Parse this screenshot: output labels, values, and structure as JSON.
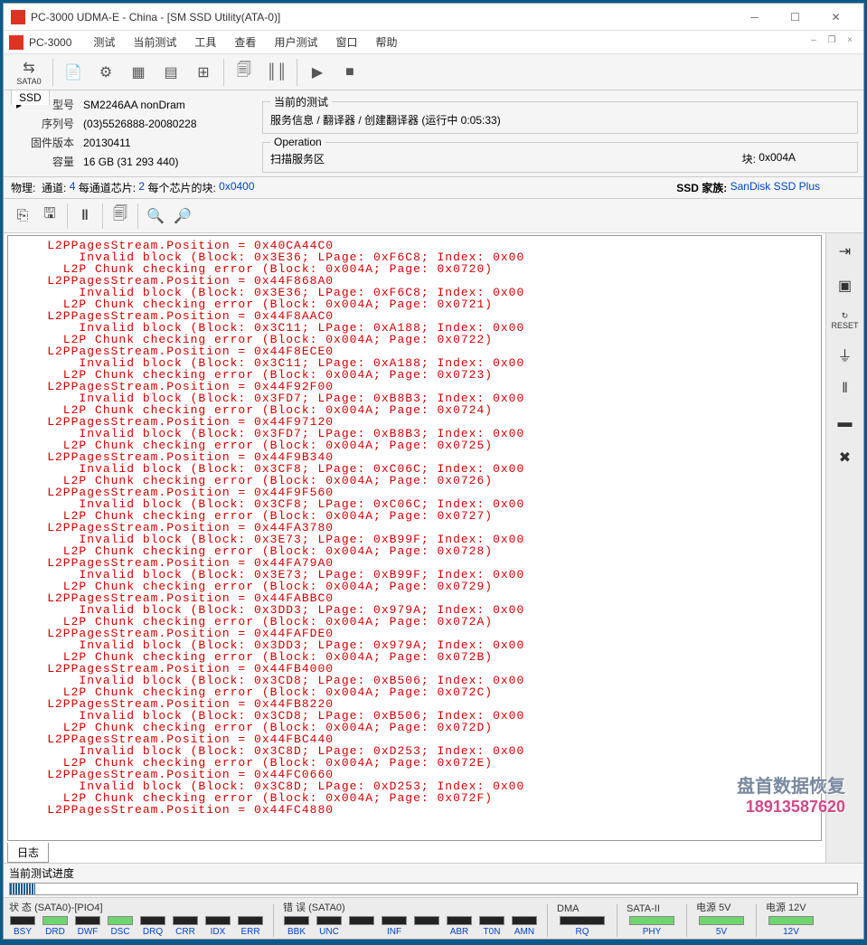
{
  "title": "PC-3000 UDMA-E - China - [SM SSD Utility(ATA-0)]",
  "app_name": "PC-3000",
  "menu": [
    "测试",
    "当前测试",
    "工具",
    "查看",
    "用户测试",
    "窗口",
    "帮助"
  ],
  "toolbar_port_label": "SATA0",
  "ssd_tab": "SSD",
  "info": {
    "model_label": "型号",
    "model": "SM2246AA nonDram",
    "serial_label": "序列号",
    "serial": "(03)5526888-20080228",
    "fw_label": "固件版本",
    "fw": "20130411",
    "cap_label": "容量",
    "cap": "16 GB (31 293 440)"
  },
  "current_test": {
    "legend": "当前的测试",
    "text": "服务信息 / 翻译器 / 创建翻译器 (运行中 0:05:33)"
  },
  "operation": {
    "legend": "Operation",
    "text": "扫描服务区",
    "block_label": "块:",
    "block_value": "0x004A"
  },
  "phys": {
    "label1": "物理:",
    "ch_label": "通道:",
    "ch": "4",
    "perch_label": "每通道芯片:",
    "perch": "2",
    "blocks_label": "每个芯片的块:",
    "blocks": "0x0400",
    "ssd_family_label": "SSD 家族:",
    "ssd_family": "SanDisk SSD Plus"
  },
  "log_lines": [
    "    L2PPagesStream.Position = 0x40CA44C0",
    "        Invalid block (Block: 0x3E36; LPage: 0xF6C8; Index: 0x00",
    "      L2P Chunk checking error (Block: 0x004A; Page: 0x0720)",
    "    L2PPagesStream.Position = 0x44F868A0",
    "        Invalid block (Block: 0x3E36; LPage: 0xF6C8; Index: 0x00",
    "      L2P Chunk checking error (Block: 0x004A; Page: 0x0721)",
    "    L2PPagesStream.Position = 0x44F8AAC0",
    "        Invalid block (Block: 0x3C11; LPage: 0xA188; Index: 0x00",
    "      L2P Chunk checking error (Block: 0x004A; Page: 0x0722)",
    "    L2PPagesStream.Position = 0x44F8ECE0",
    "        Invalid block (Block: 0x3C11; LPage: 0xA188; Index: 0x00",
    "      L2P Chunk checking error (Block: 0x004A; Page: 0x0723)",
    "    L2PPagesStream.Position = 0x44F92F00",
    "        Invalid block (Block: 0x3FD7; LPage: 0xB8B3; Index: 0x00",
    "      L2P Chunk checking error (Block: 0x004A; Page: 0x0724)",
    "    L2PPagesStream.Position = 0x44F97120",
    "        Invalid block (Block: 0x3FD7; LPage: 0xB8B3; Index: 0x00",
    "      L2P Chunk checking error (Block: 0x004A; Page: 0x0725)",
    "    L2PPagesStream.Position = 0x44F9B340",
    "        Invalid block (Block: 0x3CF8; LPage: 0xC06C; Index: 0x00",
    "      L2P Chunk checking error (Block: 0x004A; Page: 0x0726)",
    "    L2PPagesStream.Position = 0x44F9F560",
    "        Invalid block (Block: 0x3CF8; LPage: 0xC06C; Index: 0x00",
    "      L2P Chunk checking error (Block: 0x004A; Page: 0x0727)",
    "    L2PPagesStream.Position = 0x44FA3780",
    "        Invalid block (Block: 0x3E73; LPage: 0xB99F; Index: 0x00",
    "      L2P Chunk checking error (Block: 0x004A; Page: 0x0728)",
    "    L2PPagesStream.Position = 0x44FA79A0",
    "        Invalid block (Block: 0x3E73; LPage: 0xB99F; Index: 0x00",
    "      L2P Chunk checking error (Block: 0x004A; Page: 0x0729)",
    "    L2PPagesStream.Position = 0x44FABBC0",
    "        Invalid block (Block: 0x3DD3; LPage: 0x979A; Index: 0x00",
    "      L2P Chunk checking error (Block: 0x004A; Page: 0x072A)",
    "    L2PPagesStream.Position = 0x44FAFDE0",
    "        Invalid block (Block: 0x3DD3; LPage: 0x979A; Index: 0x00",
    "      L2P Chunk checking error (Block: 0x004A; Page: 0x072B)",
    "    L2PPagesStream.Position = 0x44FB4000",
    "        Invalid block (Block: 0x3CD8; LPage: 0xB506; Index: 0x00",
    "      L2P Chunk checking error (Block: 0x004A; Page: 0x072C)",
    "    L2PPagesStream.Position = 0x44FB8220",
    "        Invalid block (Block: 0x3CD8; LPage: 0xB506; Index: 0x00",
    "      L2P Chunk checking error (Block: 0x004A; Page: 0x072D)",
    "    L2PPagesStream.Position = 0x44FBC440",
    "        Invalid block (Block: 0x3C8D; LPage: 0xD253; Index: 0x00",
    "      L2P Chunk checking error (Block: 0x004A; Page: 0x072E)",
    "    L2PPagesStream.Position = 0x44FC0660",
    "        Invalid block (Block: 0x3C8D; LPage: 0xD253; Index: 0x00",
    "      L2P Chunk checking error (Block: 0x004A; Page: 0x072F)",
    "    L2PPagesStream.Position = 0x44FC4880"
  ],
  "log_tab": "日志",
  "progress_label": "当前测试进度",
  "status": {
    "group1_label": "状 态 (SATA0)-[PIO4]",
    "group1": [
      "BSY",
      "DRD",
      "DWF",
      "DSC",
      "DRQ",
      "CRR",
      "IDX",
      "ERR"
    ],
    "group1_on": [
      false,
      true,
      false,
      true,
      false,
      false,
      false,
      false
    ],
    "group2_label": "错 误 (SATA0)",
    "group2": [
      "BBK",
      "UNC",
      "",
      "INF",
      "",
      "ABR",
      "T0N",
      "AMN"
    ],
    "group2_on": [
      false,
      false,
      false,
      false,
      false,
      false,
      false,
      false
    ],
    "dma_label": "DMA",
    "dma_led": "RQ",
    "sata2_label": "SATA-II",
    "sata2_led": "PHY",
    "pwr5_label": "电源 5V",
    "pwr5_led": "5V",
    "pwr12_label": "电源 12V",
    "pwr12_led": "12V"
  },
  "watermark": {
    "text": "盘首数据恢复",
    "phone": "18913587620"
  }
}
